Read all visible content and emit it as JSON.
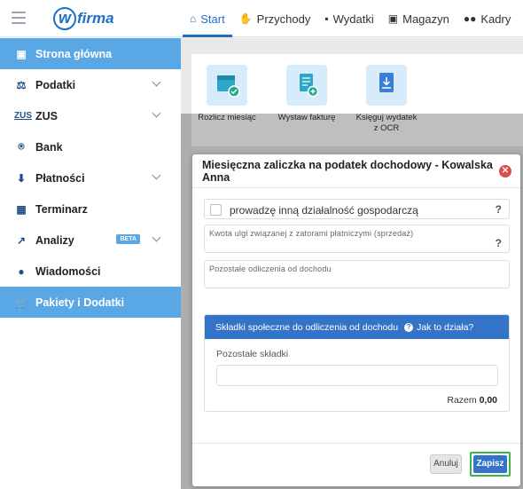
{
  "app": {
    "logo": "firma"
  },
  "topnav": [
    {
      "label": "Start",
      "icon": "home-icon",
      "active": true
    },
    {
      "label": "Przychody",
      "icon": "income-hand-icon"
    },
    {
      "label": "Wydatki",
      "icon": "wallet-icon"
    },
    {
      "label": "Magazyn",
      "icon": "warehouse-icon"
    },
    {
      "label": "Kadry",
      "icon": "users-icon"
    }
  ],
  "sidebar": {
    "items": [
      {
        "label": "Strona główna",
        "icon": "home-icon"
      },
      {
        "label": "Podatki",
        "icon": "scales-icon"
      },
      {
        "label": "ZUS",
        "icon": "zus-logo"
      },
      {
        "label": "Bank",
        "icon": "bank-icon"
      },
      {
        "label": "Płatności",
        "icon": "download-icon"
      },
      {
        "label": "Terminarz",
        "icon": "calendar-icon"
      },
      {
        "label": "Analizy",
        "icon": "chart-icon",
        "badge": "BETA"
      },
      {
        "label": "Wiadomości",
        "icon": "chat-icon"
      },
      {
        "label": "Pakiety i Dodatki",
        "icon": "cart-icon"
      }
    ]
  },
  "quick_actions": [
    {
      "label": "Rozlicz miesiąc",
      "icon": "calendar-check-icon"
    },
    {
      "label": "Wystaw fakturę",
      "icon": "invoice-add-icon"
    },
    {
      "label_line1": "Księguj wydatek",
      "label_line2": "z OCR",
      "icon": "ocr-document-icon"
    }
  ],
  "modal": {
    "title": "Miesięczna zaliczka na podatek dochodowy - Kowalska Anna",
    "checkbox_label": "prowadzę inną działalność gospodarczą",
    "help": "?",
    "ulga_label": "Kwota ulgi związanej z zatorami płatniczymi (sprzedaż)",
    "odliczenia_label": "Pozostałe odliczenia od dochodu",
    "skladki_header": "Składki społeczne do odliczenia od dochodu",
    "skladki_help_link": "Jak to działa?",
    "skladki_label": "Pozostałe składki",
    "razem_label": "Razem",
    "razem_value": "0,00",
    "cancel": "Anuluj",
    "save": "Zapisz"
  },
  "colors": {
    "accent": "#1f6fc4",
    "sidebar_active": "#5aa7e6",
    "panel_header": "#3474c8",
    "close": "#e04b4b",
    "save_outline": "#3bb54a"
  }
}
